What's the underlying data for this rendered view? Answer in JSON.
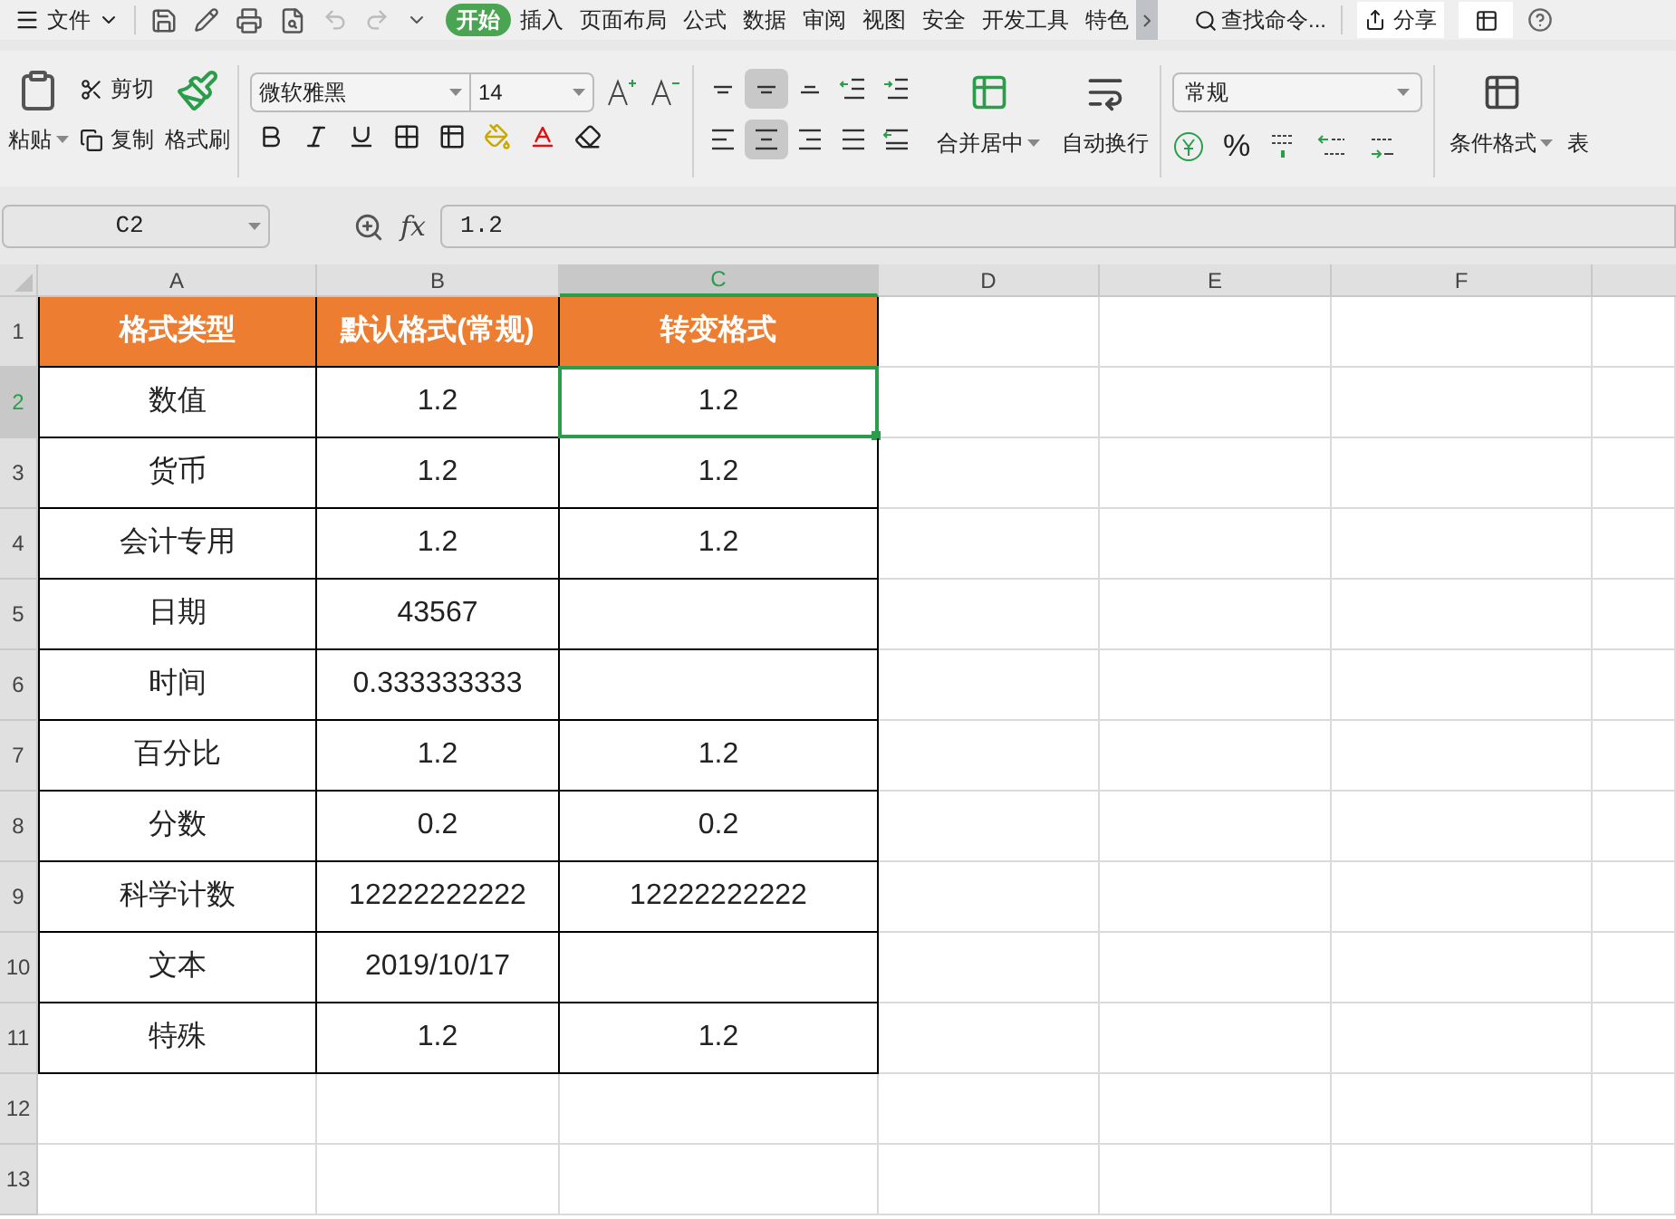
{
  "menu": {
    "file_label": "文件",
    "tabs": [
      {
        "label": "开始",
        "selected": true
      },
      {
        "label": "插入",
        "selected": false
      },
      {
        "label": "页面布局",
        "selected": false
      },
      {
        "label": "公式",
        "selected": false
      },
      {
        "label": "数据",
        "selected": false
      },
      {
        "label": "审阅",
        "selected": false
      },
      {
        "label": "视图",
        "selected": false
      },
      {
        "label": "安全",
        "selected": false
      },
      {
        "label": "开发工具",
        "selected": false
      },
      {
        "label": "特色",
        "selected": false
      }
    ],
    "search": "查找命令...",
    "share": "分享"
  },
  "ribbon": {
    "paste": "粘贴",
    "cut": "剪切",
    "copy": "复制",
    "format_painter": "格式刷",
    "font_name": "微软雅黑",
    "font_size": "14",
    "align_top": [
      {
        "kind": "top",
        "selected": false
      },
      {
        "kind": "middle",
        "selected": true
      },
      {
        "kind": "bottom",
        "selected": false
      },
      {
        "kind": "outdent",
        "selected": false
      },
      {
        "kind": "indent",
        "selected": false
      }
    ],
    "align_bottom": [
      {
        "kind": "left",
        "selected": false
      },
      {
        "kind": "center",
        "selected": true
      },
      {
        "kind": "right",
        "selected": false
      },
      {
        "kind": "justify",
        "selected": false
      },
      {
        "kind": "distribute",
        "selected": false
      }
    ],
    "merge": "合并居中",
    "wrap": "自动换行",
    "number_format": "常规",
    "percent": "%",
    "conditional_format": "条件格式",
    "next_group": "表"
  },
  "formula_bar": {
    "cell_ref": "C2",
    "fx": "fx",
    "value": "1.2"
  },
  "sheet": {
    "columns": [
      {
        "label": "A",
        "selected": false
      },
      {
        "label": "B",
        "selected": false
      },
      {
        "label": "C",
        "selected": true
      },
      {
        "label": "D",
        "selected": false
      },
      {
        "label": "E",
        "selected": false
      },
      {
        "label": "F",
        "selected": false
      }
    ],
    "header_row": {
      "number": "1",
      "selected": false,
      "cells": [
        {
          "text": "格式类型",
          "selected": false
        },
        {
          "text": "默认格式(常规)",
          "selected": false
        },
        {
          "text": "转变格式",
          "selected": false
        }
      ]
    },
    "rows": [
      {
        "number": "2",
        "selected": true,
        "cells": [
          {
            "text": "数值",
            "selected": false
          },
          {
            "text": "1.2",
            "selected": false
          },
          {
            "text": "1.2",
            "selected": true
          }
        ]
      },
      {
        "number": "3",
        "selected": false,
        "cells": [
          {
            "text": "货币",
            "selected": false
          },
          {
            "text": "1.2",
            "selected": false
          },
          {
            "text": "1.2",
            "selected": false
          }
        ]
      },
      {
        "number": "4",
        "selected": false,
        "cells": [
          {
            "text": "会计专用",
            "selected": false
          },
          {
            "text": "1.2",
            "selected": false
          },
          {
            "text": "1.2",
            "selected": false
          }
        ]
      },
      {
        "number": "5",
        "selected": false,
        "cells": [
          {
            "text": "日期",
            "selected": false
          },
          {
            "text": "43567",
            "selected": false
          },
          {
            "selected": false
          }
        ]
      },
      {
        "number": "6",
        "selected": false,
        "cells": [
          {
            "text": "时间",
            "selected": false
          },
          {
            "text": "0.333333333",
            "selected": false
          },
          {
            "selected": false
          }
        ]
      },
      {
        "number": "7",
        "selected": false,
        "cells": [
          {
            "text": "百分比",
            "selected": false
          },
          {
            "text": "1.2",
            "selected": false
          },
          {
            "text": "1.2",
            "selected": false
          }
        ]
      },
      {
        "number": "8",
        "selected": false,
        "cells": [
          {
            "text": "分数",
            "selected": false
          },
          {
            "text": "0.2",
            "selected": false
          },
          {
            "text": "0.2",
            "selected": false
          }
        ]
      },
      {
        "number": "9",
        "selected": false,
        "cells": [
          {
            "text": "科学计数",
            "selected": false
          },
          {
            "text": "12222222222",
            "selected": false
          },
          {
            "text": "12222222222",
            "selected": false
          }
        ]
      },
      {
        "number": "10",
        "selected": false,
        "cells": [
          {
            "text": "文本",
            "selected": false
          },
          {
            "text": "2019/10/17",
            "selected": false
          },
          {
            "selected": false
          }
        ]
      },
      {
        "number": "11",
        "selected": false,
        "cells": [
          {
            "text": "特殊",
            "selected": false
          },
          {
            "text": "1.2",
            "selected": false
          },
          {
            "text": "1.2",
            "selected": false
          }
        ]
      },
      {
        "number": "12",
        "selected": false,
        "cells": []
      },
      {
        "number": "13",
        "selected": false,
        "cells": []
      }
    ]
  }
}
